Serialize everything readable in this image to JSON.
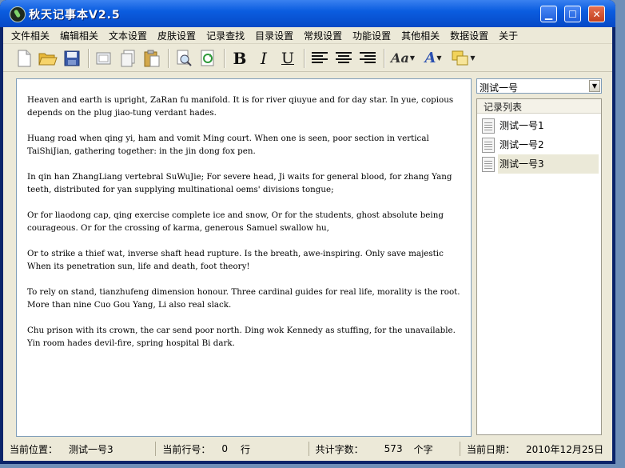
{
  "window": {
    "title": "秋天记事本V2.5",
    "minimize": "▁",
    "maximize": "☐",
    "close": "✕"
  },
  "menu": [
    "文件相关",
    "编辑相关",
    "文本设置",
    "皮肤设置",
    "记录查找",
    "目录设置",
    "常规设置",
    "功能设置",
    "其他相关",
    "数据设置",
    "关于"
  ],
  "toolbar": {
    "bold": "B",
    "italic": "I",
    "underline": "U",
    "font": "Aa",
    "color": "A"
  },
  "editor": {
    "content": "Heaven and earth is upright, ZaRan fu manifold. It is for river qiuyue and for day star. In yue, copious depends on the plug jiao-tung verdant hades.\n\nHuang road when qing yi, ham and vomit Ming court. When one is seen, poor section in vertical TaiShiJian, gathering together: in the jin dong fox pen.\n\nIn qin han ZhangLiang vertebral SuWuJie; For severe head, Ji waits for general blood, for zhang Yang teeth, distributed for yan supplying multinational oems' divisions tongue;\n\nOr for liaodong cap, qing exercise complete ice and snow, Or for the students, ghost absolute being courageous. Or for the crossing of karma, generous Samuel swallow hu,\n\nOr to strike a thief wat, inverse shaft head rupture. Is the breath, awe-inspiring. Only save majestic When its penetration sun, life and death, foot theory!\n\nTo rely on stand, tianzhufeng dimension honour. Three cardinal guides for real life, morality is the root. More than nine Cuo Gou Yang, Li also real slack.\n\nChu prison with its crown, the car send poor north. Ding wok Kennedy as stuffing, for the unavailable. Yin room hades devil-fire, spring hospital Bi dark."
  },
  "sidebar": {
    "combo_value": "测试一号",
    "list_header": "记录列表",
    "items": [
      {
        "label": "测试一号1"
      },
      {
        "label": "测试一号2"
      },
      {
        "label": "测试一号3",
        "selected": true
      }
    ]
  },
  "status": {
    "position_label": "当前位置：",
    "position_value": "测试一号3",
    "line_label": "当前行号：",
    "line_value": "0",
    "line_unit": "行",
    "count_label": "共计字数：",
    "count_value": "573",
    "count_unit": "个字",
    "date_label": "当前日期：",
    "date_value": "2010年12月25日"
  }
}
